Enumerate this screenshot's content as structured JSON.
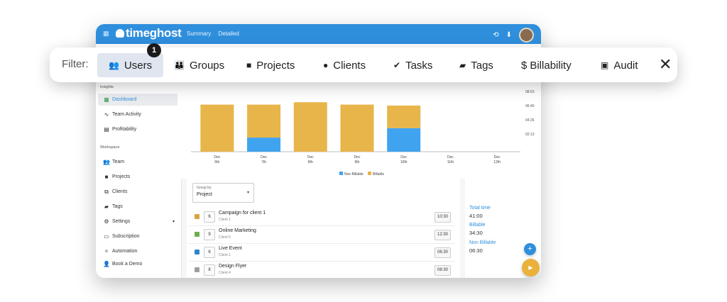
{
  "app": {
    "logo": "timeghost",
    "nav": [
      "Summary",
      "Detailed"
    ]
  },
  "sidebar": {
    "insights_label": "Insights",
    "insights": [
      {
        "label": "Dashboard",
        "icon": "grid-icon",
        "active": true
      },
      {
        "label": "Team Activity",
        "icon": "activity-icon"
      },
      {
        "label": "Profitability",
        "icon": "chart-icon"
      }
    ],
    "workspace_label": "Workspace",
    "workspace": [
      {
        "label": "Team",
        "icon": "team-icon"
      },
      {
        "label": "Projects",
        "icon": "folder-icon"
      },
      {
        "label": "Clients",
        "icon": "clients-icon"
      },
      {
        "label": "Tags",
        "icon": "tag-icon"
      },
      {
        "label": "Settings",
        "icon": "gear-icon"
      },
      {
        "label": "Subscription",
        "icon": "monitor-icon"
      },
      {
        "label": "Automation",
        "icon": "wand-icon"
      },
      {
        "label": "Book a Demo",
        "icon": "people-icon"
      }
    ]
  },
  "chart_data": {
    "type": "bar",
    "categories": [
      "Dec 6th",
      "Dec 7th",
      "Dec 8th",
      "Dec 9th",
      "Dec 10th",
      "Dec 11th",
      "Dec 12th"
    ],
    "x_labels": [
      [
        "Dec",
        "6th"
      ],
      [
        "Dec",
        "7th"
      ],
      [
        "Dec",
        "8th"
      ],
      [
        "Dec",
        "9th"
      ],
      [
        "Dec",
        "10th"
      ],
      [
        "Dec",
        "11th"
      ],
      [
        "Dec",
        "12th"
      ]
    ],
    "series": [
      {
        "name": "Non Billable",
        "color": "#3fa3f0",
        "values": [
          0,
          1.5,
          0,
          0,
          2.5,
          0,
          0
        ]
      },
      {
        "name": "Billable",
        "color": "#e8b54a",
        "values": [
          5.0,
          3.5,
          5.25,
          5.0,
          2.4,
          0,
          0
        ]
      }
    ],
    "y_tick_labels": [
      "08:53",
      "06:40",
      "04:26",
      "02:13"
    ],
    "ylim": [
      0,
      8.88
    ],
    "legend": "bottom-center"
  },
  "groupby": {
    "label": "Group by",
    "value": "Project"
  },
  "projects": [
    {
      "color": "#d7a53c",
      "count": "6",
      "name": "Campaign for client 1",
      "client": "Client 1",
      "time": "10:30"
    },
    {
      "color": "#6ab04c",
      "count": "9",
      "name": "Online Marketing",
      "client": "Client 5",
      "time": "12:30"
    },
    {
      "color": "#2e86c9",
      "count": "6",
      "name": "Live Event",
      "client": "Client 1",
      "time": "06:30"
    },
    {
      "color": "#9e9e9e",
      "count": "8",
      "name": "Design Flyer",
      "client": "Client 4",
      "time": "08:30"
    }
  ],
  "totals": {
    "total_label": "Total time",
    "total": "41:00",
    "billable_label": "Billable",
    "billable": "34:30",
    "nonbillable_label": "Non Billable",
    "nonbillable": "06:30"
  },
  "filter": {
    "label": "Filter:",
    "badge": "1",
    "items": [
      {
        "label": "Users",
        "icon": "users-icon"
      },
      {
        "label": "Groups",
        "icon": "groups-icon"
      },
      {
        "label": "Projects",
        "icon": "folder-icon"
      },
      {
        "label": "Clients",
        "icon": "person-icon"
      },
      {
        "label": "Tasks",
        "icon": "check-circle-icon"
      },
      {
        "label": "Tags",
        "icon": "tag-icon"
      },
      {
        "label": "Billability",
        "icon": "dollar-icon"
      },
      {
        "label": "Audit",
        "icon": "audit-icon"
      }
    ]
  }
}
